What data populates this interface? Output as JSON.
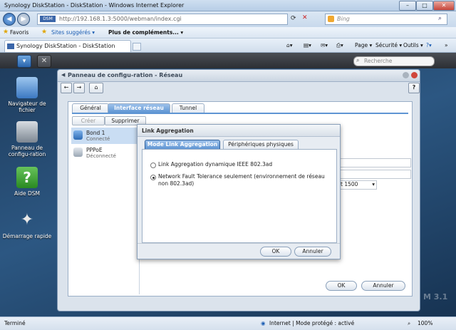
{
  "browser": {
    "window_title": "Synology DiskStation - DiskStation - Windows Internet Explorer",
    "url": "http://192.168.1.3:5000/webman/index.cgi",
    "search_placeholder": "Bing",
    "favorites_label": "Favoris",
    "suggested_sites": "Sites suggérés ▾",
    "more_addons": "Plus de compléments... ▾",
    "tab_title": "Synology DiskStation - DiskStation",
    "cmd_page": "Page ▾",
    "cmd_security": "Sécurité ▾",
    "cmd_tools": "Outils ▾",
    "cmd_help": "?▾"
  },
  "dsm": {
    "search_placeholder": "Recherche",
    "desktop_icons": [
      {
        "label": "Navigateur de fichier",
        "icon": "folder-search-icon"
      },
      {
        "label": "Panneau de configu-ration",
        "icon": "tools-icon"
      },
      {
        "label": "Aide DSM",
        "icon": "help-icon"
      },
      {
        "label": "Démarrage rapide",
        "icon": "magic-wand-icon"
      }
    ],
    "watermark": "M 3.1"
  },
  "window": {
    "title": "Panneau de configu-ration - Réseau",
    "tabs": [
      "Général",
      "Interface réseau",
      "Tunnel"
    ],
    "active_tab": "Interface réseau",
    "toolbar": {
      "create": "Créer",
      "delete": "Supprimer"
    },
    "interfaces": [
      {
        "name": "Bond 1",
        "status": "Connecté"
      },
      {
        "name": "PPPoE",
        "status": "Déconnecté"
      }
    ],
    "mtu_value": "t 1500",
    "ok": "OK",
    "cancel": "Annuler"
  },
  "dialog": {
    "title": "Link Aggregation",
    "tabs": [
      "Mode Link Aggregation",
      "Périphériques physiques"
    ],
    "options": [
      {
        "label": "Link Aggregation dynamique IEEE 802.3ad",
        "selected": false
      },
      {
        "label": "Network Fault Tolerance seulement (environnement de réseau non 802.3ad)",
        "selected": true
      }
    ],
    "ok": "OK",
    "cancel": "Annuler"
  },
  "statusbar": {
    "left": "Terminé",
    "zone": "Internet | Mode protégé : activé",
    "zoom": "100%"
  }
}
